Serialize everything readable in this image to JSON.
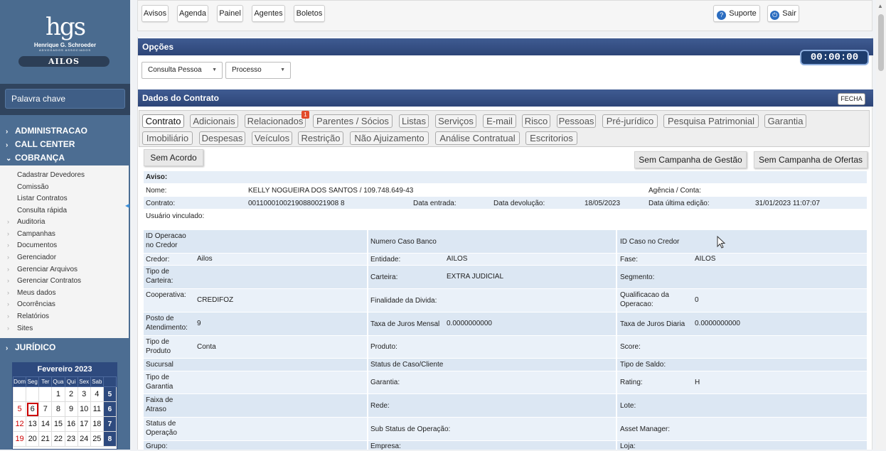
{
  "logo": {
    "mark": "hgs",
    "name": "Henrique G. Schroeder",
    "sub": "ADVOGADOS ASSOCIADOS",
    "brand": "AILOS"
  },
  "search": {
    "keyword_label": "Palavra chave"
  },
  "menu": {
    "sections": [
      {
        "label": "ADMINISTRACAO",
        "arrow": "›"
      },
      {
        "label": "CALL CENTER",
        "arrow": "›"
      },
      {
        "label": "COBRANÇA",
        "arrow": "⌄"
      }
    ],
    "cobranca_items": [
      "Cadastrar Devedores",
      "Comissão",
      "Listar Contratos",
      "Consulta rápida"
    ],
    "cobranca_groups": [
      "Auditoria",
      "Campanhas",
      "Documentos",
      "Gerenciador",
      "Gerenciar Arquivos",
      "Gerenciar Contratos",
      "Meus dados",
      "Ocorrências",
      "Relatórios",
      "Sites"
    ],
    "juridico": "JURÍDICO"
  },
  "calendar": {
    "title": "Fevereiro 2023",
    "weekdays": [
      "Dom",
      "Seg",
      "Ter",
      "Qua",
      "Qui",
      "Sex",
      "Sab",
      ""
    ],
    "rows": [
      [
        "",
        "",
        "",
        "1",
        "2",
        "3",
        "4",
        "5"
      ],
      [
        "5",
        "6",
        "7",
        "8",
        "9",
        "10",
        "11",
        "6"
      ],
      [
        "12",
        "13",
        "14",
        "15",
        "16",
        "17",
        "18",
        "7"
      ],
      [
        "19",
        "20",
        "21",
        "22",
        "23",
        "24",
        "25",
        "8"
      ]
    ],
    "today": "6"
  },
  "topbar": {
    "buttons": [
      "Avisos",
      "Agenda",
      "Painel",
      "Agentes",
      "Boletos"
    ],
    "suporte": "Suporte",
    "sair": "Sair"
  },
  "opcoes": {
    "title": "Opções",
    "consulta_select": "Consulta Pessoa",
    "processo_select": "Processo",
    "timer": "00:00:00"
  },
  "contrato_panel": {
    "title": "Dados do Contrato",
    "fecha": "FECHA",
    "tabs_row1": [
      "Contrato",
      "Adicionais",
      "Relacionados",
      "Parentes / Sócios",
      "Listas",
      "Serviços",
      "E-mail",
      "Risco",
      "Pessoas",
      "Pré-jurídico",
      "Pesquisa Patrimonial",
      "Garantia"
    ],
    "tabs_row2": [
      "Imobiliário",
      "Despesas",
      "Veículos",
      "Restrição",
      "Não Ajuizamento",
      "Análise Contratual",
      "Escritorios"
    ],
    "relacionados_badge": "1",
    "sem_acordo": "Sem Acordo",
    "sem_campanha_gestao": "Sem Campanha de Gestão",
    "sem_campanha_ofertas": "Sem Campanha de Ofertas"
  },
  "aviso": {
    "aviso_label": "Aviso:",
    "nome_label": "Nome:",
    "nome_value": "KELLY NOGUEIRA DOS SANTOS / 109.748.649-43",
    "agencia_label": "Agência / Conta:",
    "contrato_label": "Contrato:",
    "contrato_value": "00110001002190880021908 8",
    "data_entrada_label": "Data entrada:",
    "data_devolucao_label": "Data devolução:",
    "data_devolucao_value": "18/05/2023",
    "data_ultima_label": "Data última edição:",
    "data_ultima_value": "31/01/2023 11:07:07",
    "usuario_label": "Usuário vinculado:"
  },
  "details": [
    {
      "l1": "ID Operacao no Credor",
      "v1": "",
      "l2": "Numero Caso Banco",
      "v2": "",
      "l3": "ID Caso no Credor",
      "v3": ""
    },
    {
      "l1": "Credor:",
      "v1": "Ailos",
      "l2": "Entidade:",
      "v2": "AILOS",
      "l3": "Fase:",
      "v3": "AILOS"
    },
    {
      "l1": "Tipo de Carteira:",
      "v1": "",
      "l2": "Carteira:",
      "v2": "EXTRA JUDICIAL",
      "l3": "Segmento:",
      "v3": ""
    },
    {
      "l1": "Cooperativa:",
      "v1": "CREDIFOZ",
      "l2": "Finalidade da Divida:",
      "v2": "",
      "l3": "Qualificacao da Operacao:",
      "v3": "0"
    },
    {
      "l1": "Posto de Atendimento:",
      "v1": "9",
      "l2": "Taxa de Juros Mensal",
      "v2": "0.0000000000",
      "l3": "Taxa de Juros Diaria",
      "v3": "0.0000000000"
    },
    {
      "l1": "Tipo de Produto",
      "v1": "Conta",
      "l2": "Produto:",
      "v2": "",
      "l3": "Score:",
      "v3": ""
    },
    {
      "l1": "Sucursal",
      "v1": "",
      "l2": "Status de Caso/Cliente",
      "v2": "",
      "l3": "Tipo de Saldo:",
      "v3": ""
    },
    {
      "l1": "Tipo de Garantia",
      "v1": "",
      "l2": "Garantia:",
      "v2": "",
      "l3": "Rating:",
      "v3": "H"
    },
    {
      "l1": "Faixa de Atraso",
      "v1": "",
      "l2": "Rede:",
      "v2": "",
      "l3": "Lote:",
      "v3": ""
    },
    {
      "l1": "Status de Operação",
      "v1": "",
      "l2": "Sub Status de Operação:",
      "v2": "",
      "l3": "Asset Manager:",
      "v3": ""
    },
    {
      "l1": "Grupo:",
      "v1": "",
      "l2": "Empresa:",
      "v2": "",
      "l3": "Loja:",
      "v3": ""
    }
  ]
}
